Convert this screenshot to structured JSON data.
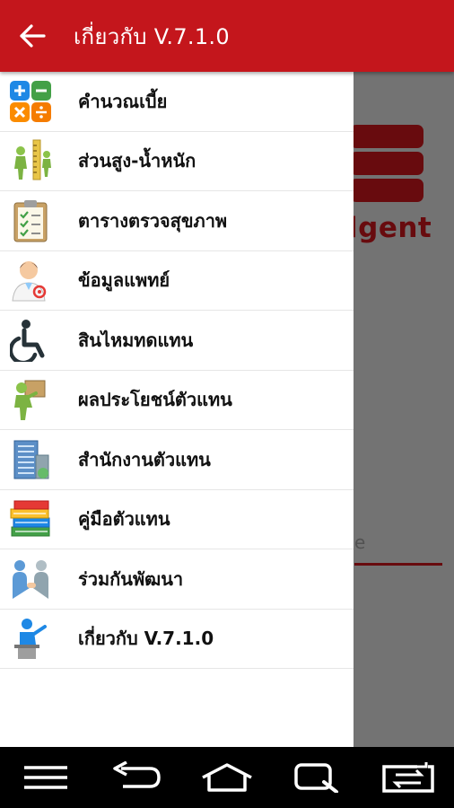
{
  "appbar": {
    "title": "เกี่ยวกับ V.7.1.0",
    "back_icon": "arrow-left-icon"
  },
  "background": {
    "logo_text": "lgent",
    "input_hint": "e"
  },
  "drawer": {
    "items": [
      {
        "label": "คำนวณเบี้ย",
        "icon": "calculator-icon"
      },
      {
        "label": "ส่วนสูง-น้ำหนัก",
        "icon": "height-weight-icon"
      },
      {
        "label": "ตารางตรวจสุขภาพ",
        "icon": "clipboard-checklist-icon"
      },
      {
        "label": "ข้อมูลแพทย์",
        "icon": "doctor-icon"
      },
      {
        "label": "สินไหมทดแทน",
        "icon": "wheelchair-icon"
      },
      {
        "label": "ผลประโยชน์ตัวแทน",
        "icon": "person-carrying-box-icon"
      },
      {
        "label": "สำนักงานตัวแทน",
        "icon": "office-building-icon"
      },
      {
        "label": "คู่มือตัวแทน",
        "icon": "books-icon"
      },
      {
        "label": "ร่วมกันพัฒนา",
        "icon": "handshake-people-icon"
      },
      {
        "label": "เกี่ยวกับ V.7.1.0",
        "icon": "presenter-icon"
      }
    ]
  },
  "navbar": {
    "buttons": [
      "menu-icon",
      "back-icon",
      "home-icon",
      "search-icon",
      "switch-apps-icon"
    ]
  },
  "colors": {
    "brand_red": "#c4161c",
    "nav_black": "#000000"
  }
}
